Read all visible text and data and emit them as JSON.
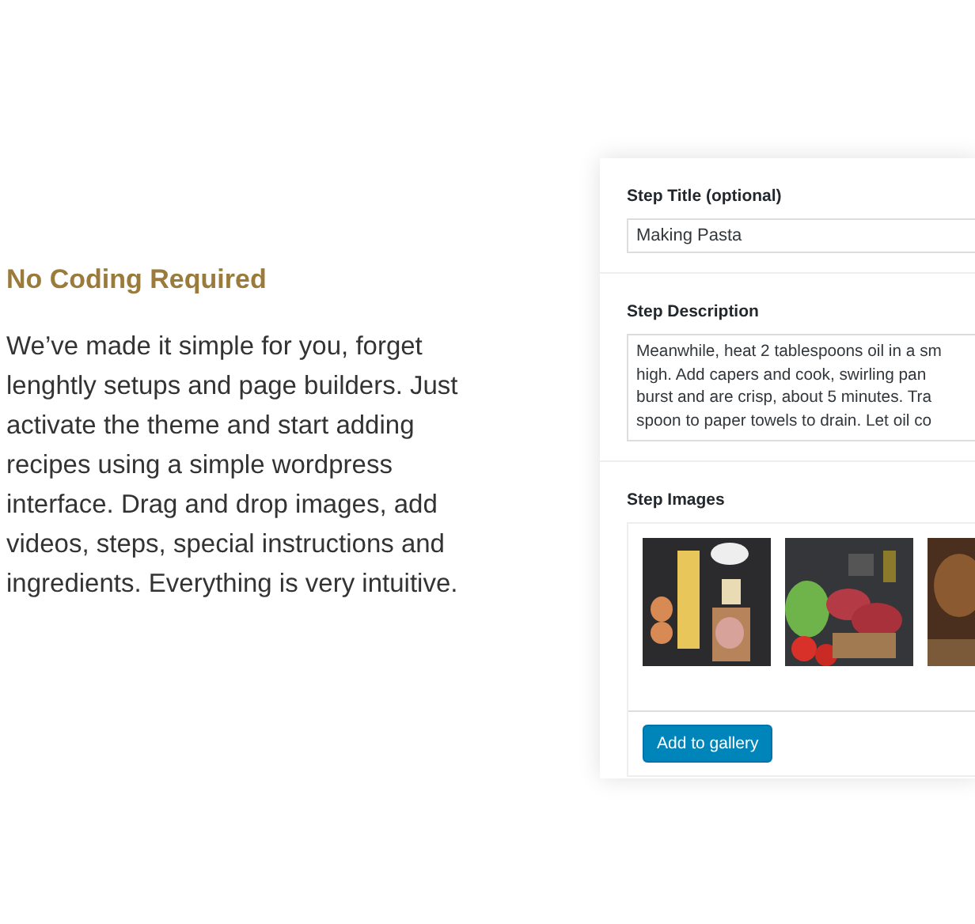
{
  "feature": {
    "heading": "No Coding Required",
    "body": "We’ve made it simple for you, forget lenghtly setups and page builders. Just activate the theme and start adding recipes using a simple wordpress interface. Drag and drop images, add videos, steps, special instructions and ingredients. Everything is very intuitive."
  },
  "editor": {
    "title_field": {
      "label": "Step Title (optional)",
      "value": "Making Pasta"
    },
    "description_field": {
      "label": "Step Description",
      "lines": [
        "Meanwhile, heat 2 tablespoons oil in a sm",
        "high. Add capers and cook, swirling pan",
        "burst and are crisp, about 5 minutes. Tra",
        "spoon to paper towels to drain. Let oil co"
      ]
    },
    "images": {
      "label": "Step Images",
      "button": "Add to gallery"
    }
  }
}
